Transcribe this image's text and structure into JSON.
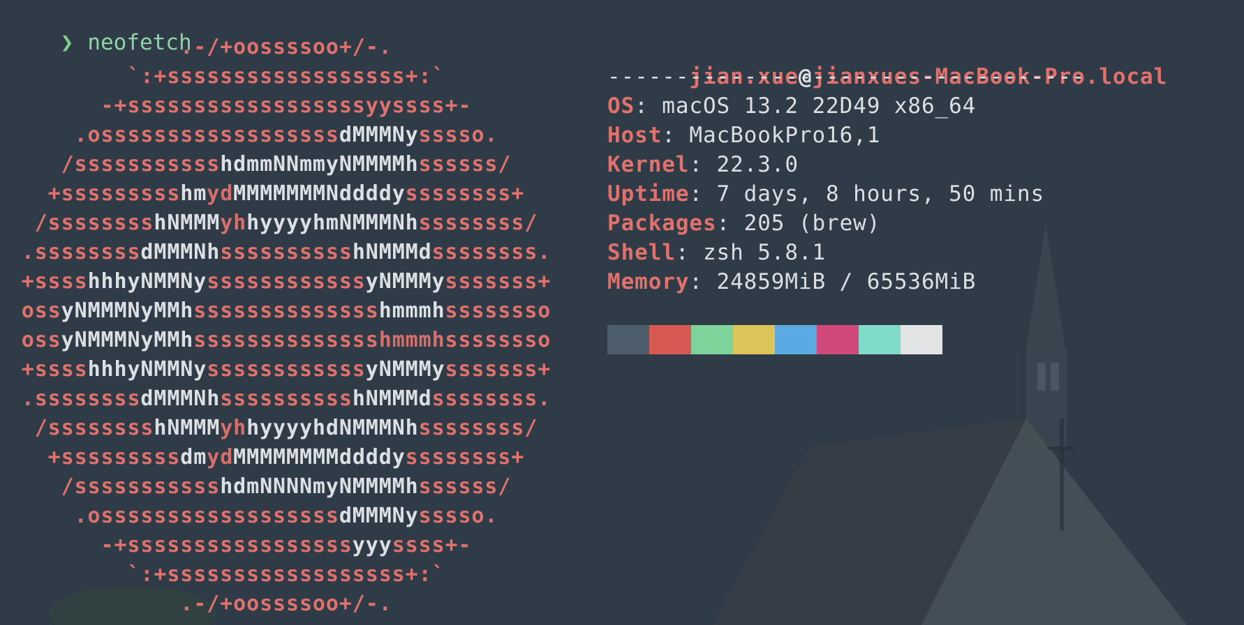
{
  "prompt": {
    "symbol": "❯",
    "command": "neofetch"
  },
  "logo_lines": [
    [
      {
        "t": ".-/+oossssoo+/-.",
        "c": "c1"
      }
    ],
    [
      {
        "t": "`:+ssssssssssssssssss+:`",
        "c": "c1"
      }
    ],
    [
      {
        "t": "-+ssssssssssssssssssyyssss+-",
        "c": "c1"
      }
    ],
    [
      {
        "t": ".ossssssssssssssssss",
        "c": "c1"
      },
      {
        "t": "dMMMNy",
        "c": "c2"
      },
      {
        "t": "sssso.",
        "c": "c1"
      }
    ],
    [
      {
        "t": "/sssssssssss",
        "c": "c1"
      },
      {
        "t": "hdmmNNmmyNMMMMh",
        "c": "c2"
      },
      {
        "t": "ssssss/",
        "c": "c1"
      }
    ],
    [
      {
        "t": "+sssssssss",
        "c": "c1"
      },
      {
        "t": "hm",
        "c": "c2"
      },
      {
        "t": "yd",
        "c": "c3"
      },
      {
        "t": "MMMMMMMNddddy",
        "c": "c2"
      },
      {
        "t": "ssssssss+",
        "c": "c1"
      }
    ],
    [
      {
        "t": "/ssssssss",
        "c": "c1"
      },
      {
        "t": "hNMMM",
        "c": "c2"
      },
      {
        "t": "yh",
        "c": "c3"
      },
      {
        "t": "hyyyyhmNMMMNh",
        "c": "c2"
      },
      {
        "t": "ssssssss/",
        "c": "c1"
      }
    ],
    [
      {
        "t": ".ssssssss",
        "c": "c1"
      },
      {
        "t": "dMMMNh",
        "c": "c2"
      },
      {
        "t": "ssssssssss",
        "c": "c1"
      },
      {
        "t": "hNMMMd",
        "c": "c2"
      },
      {
        "t": "ssssssss.",
        "c": "c1"
      }
    ],
    [
      {
        "t": "+ssss",
        "c": "c1"
      },
      {
        "t": "hhhyNMMNy",
        "c": "c2"
      },
      {
        "t": "ssssssssssss",
        "c": "c1"
      },
      {
        "t": "yNMMMy",
        "c": "c2"
      },
      {
        "t": "sssssss+",
        "c": "c1"
      }
    ],
    [
      {
        "t": "oss",
        "c": "c1"
      },
      {
        "t": "yNMMMNyMMh",
        "c": "c2"
      },
      {
        "t": "ssssssssssssss",
        "c": "c1"
      },
      {
        "t": "hmmmh",
        "c": "c2"
      },
      {
        "t": "ssssssso",
        "c": "c1"
      }
    ],
    [
      {
        "t": "oss",
        "c": "c1"
      },
      {
        "t": "yNMMMNyMMh",
        "c": "c2"
      },
      {
        "t": "ssssssssssssss",
        "c": "c1"
      },
      {
        "t": "hmmmh",
        "c": "c3"
      },
      {
        "t": "ssssssso",
        "c": "c1"
      }
    ],
    [
      {
        "t": "+ssss",
        "c": "c1"
      },
      {
        "t": "hhhyNMMNy",
        "c": "c2"
      },
      {
        "t": "ssssssssssss",
        "c": "c1"
      },
      {
        "t": "yNMMMy",
        "c": "c2"
      },
      {
        "t": "sssssss+",
        "c": "c1"
      }
    ],
    [
      {
        "t": ".ssssssss",
        "c": "c1"
      },
      {
        "t": "dMMMNh",
        "c": "c2"
      },
      {
        "t": "ssssssssss",
        "c": "c1"
      },
      {
        "t": "hNMMMd",
        "c": "c2"
      },
      {
        "t": "ssssssss.",
        "c": "c1"
      }
    ],
    [
      {
        "t": "/ssssssss",
        "c": "c1"
      },
      {
        "t": "hNMMM",
        "c": "c2"
      },
      {
        "t": "yh",
        "c": "c3"
      },
      {
        "t": "hyyyyhdNMMMNh",
        "c": "c2"
      },
      {
        "t": "ssssssss/",
        "c": "c1"
      }
    ],
    [
      {
        "t": "+sssssssss",
        "c": "c1"
      },
      {
        "t": "dm",
        "c": "c2"
      },
      {
        "t": "yd",
        "c": "c3"
      },
      {
        "t": "MMMMMMMMddddy",
        "c": "c2"
      },
      {
        "t": "ssssssss+",
        "c": "c1"
      }
    ],
    [
      {
        "t": "/sssssssssss",
        "c": "c1"
      },
      {
        "t": "hdmNNNNmyNMMMMh",
        "c": "c2"
      },
      {
        "t": "ssssss/",
        "c": "c1"
      }
    ],
    [
      {
        "t": ".ossssssssssssssssss",
        "c": "c1"
      },
      {
        "t": "dMMMNy",
        "c": "c2"
      },
      {
        "t": "sssso.",
        "c": "c1"
      }
    ],
    [
      {
        "t": "-+sssssssssssssssss",
        "c": "c1"
      },
      {
        "t": "yyy",
        "c": "c2"
      },
      {
        "t": "ssss+-",
        "c": "c1"
      }
    ],
    [
      {
        "t": "`:+ssssssssssssssssss+:`",
        "c": "c1"
      }
    ],
    [
      {
        "t": ".-/+oossssoo+/-.",
        "c": "c1"
      }
    ]
  ],
  "info": {
    "user": "jian.xue",
    "at": "@",
    "host": "jianxues-MacBook-Pro.local",
    "separator": "-----------------------------------",
    "rows": [
      {
        "key": "OS",
        "value": "macOS 13.2 22D49 x86_64"
      },
      {
        "key": "Host",
        "value": "MacBookPro16,1"
      },
      {
        "key": "Kernel",
        "value": "22.3.0"
      },
      {
        "key": "Uptime",
        "value": "7 days, 8 hours, 50 mins"
      },
      {
        "key": "Packages",
        "value": "205 (brew)"
      },
      {
        "key": "Shell",
        "value": "zsh 5.8.1"
      },
      {
        "key": "Memory",
        "value": "24859MiB / 65536MiB"
      }
    ]
  },
  "palette": [
    "#4e5d6b",
    "#d65a52",
    "#7dd39a",
    "#dcc45a",
    "#5aa9e2",
    "#d1497a",
    "#80dcc8",
    "#e1e3e5"
  ]
}
